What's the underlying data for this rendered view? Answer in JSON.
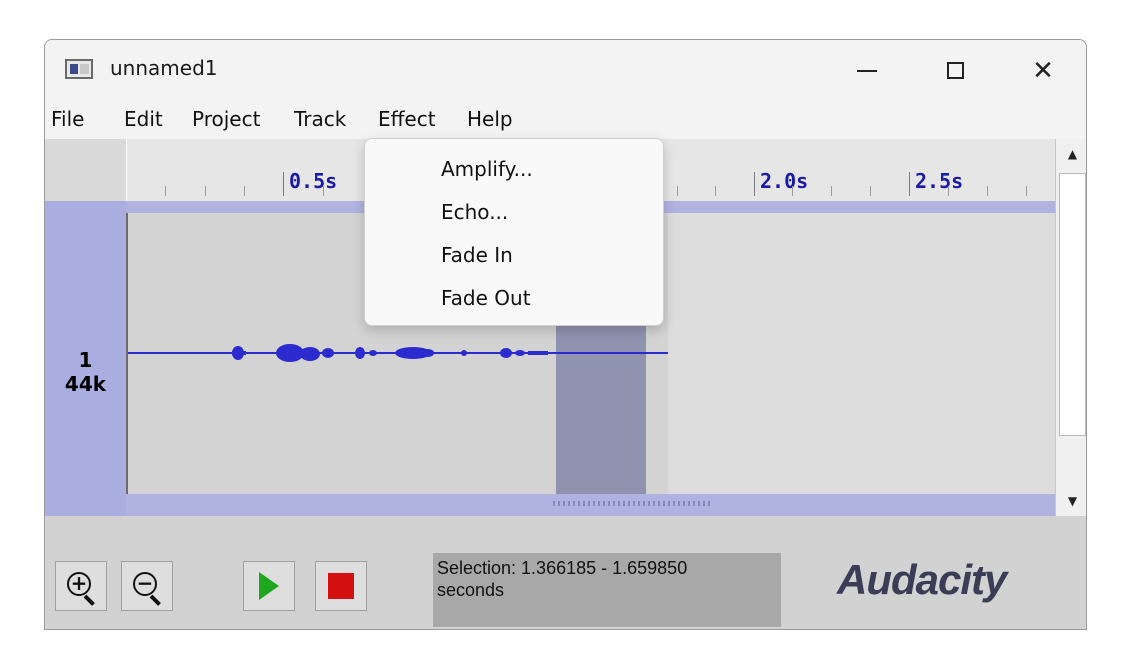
{
  "window": {
    "title": "unnamed1"
  },
  "menu": [
    "File",
    "Edit",
    "Project",
    "Track",
    "Effect",
    "Help"
  ],
  "effect_menu": [
    "Amplify...",
    "Echo...",
    "Fade In",
    "Fade Out"
  ],
  "ruler": {
    "labels": [
      "0.5s",
      "2.0s",
      "2.5s"
    ]
  },
  "track": {
    "number": "1",
    "rate": "44k"
  },
  "status": {
    "line1": "Selection: 1.366185 - 1.659850",
    "line2": "seconds"
  },
  "logo": "Audacity",
  "colors": {
    "waveform": "#2b2bd0",
    "selection": "#8f93b0",
    "play": "#1fa81f",
    "stop": "#d41010"
  },
  "icons": {
    "zoom_in": "zoom-in-icon",
    "zoom_out": "zoom-out-icon",
    "play": "play-icon",
    "stop": "stop-icon"
  }
}
